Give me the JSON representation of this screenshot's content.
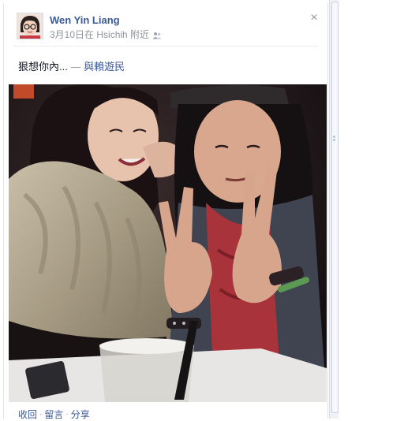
{
  "post": {
    "author_name": "Wen Yin Liang",
    "date": "3月10日在 Hsichih 附近",
    "audience_icon": "friends-icon",
    "status_text": "狠想你內...",
    "status_dash": "—",
    "tag_with": "與賴遊民",
    "close_symbol": "×"
  },
  "actions": {
    "collapse": "收回",
    "comment": "留言",
    "share": "分享",
    "separator": "·"
  },
  "colors": {
    "link": "#3b5998",
    "meta": "#90949c"
  }
}
